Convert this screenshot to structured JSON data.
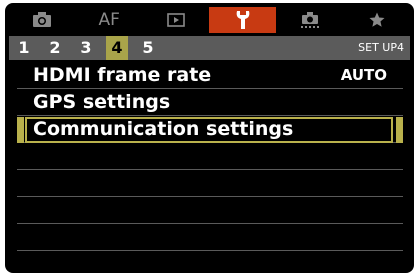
{
  "tabs": [
    {
      "icon": "camera-icon",
      "text": ""
    },
    {
      "icon": "af-tab",
      "text": "AF"
    },
    {
      "icon": "playback-icon",
      "text": ""
    },
    {
      "icon": "wrench-icon",
      "text": ""
    },
    {
      "icon": "custom-function-icon",
      "text": ""
    },
    {
      "icon": "star-icon",
      "text": ""
    }
  ],
  "active_tab": 3,
  "pages": [
    "1",
    "2",
    "3",
    "4",
    "5"
  ],
  "active_page": 3,
  "page_label": "SET UP4",
  "menu": {
    "items": [
      {
        "label": "HDMI frame rate",
        "value": "AUTO"
      },
      {
        "label": "GPS settings",
        "value": ""
      },
      {
        "label": "Communication settings",
        "value": ""
      },
      {
        "label": "",
        "value": ""
      },
      {
        "label": "",
        "value": ""
      },
      {
        "label": "",
        "value": ""
      },
      {
        "label": "",
        "value": ""
      }
    ],
    "selected_index": 2
  },
  "colors": {
    "active_tab": "#c83a12",
    "page_highlight": "#a9a44a",
    "selection_frame": "#b9b14c",
    "divider": "#5a5a5a"
  }
}
